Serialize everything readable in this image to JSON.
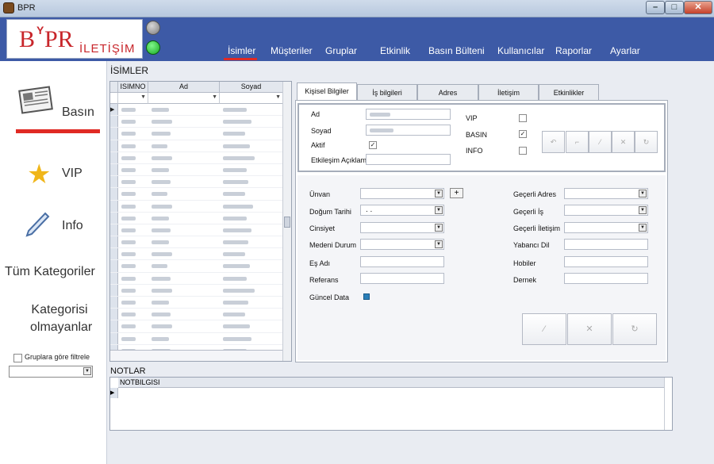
{
  "window": {
    "title": "BPR",
    "min": "–",
    "max": "□",
    "close": "✕"
  },
  "logo": {
    "b": "B",
    "y": "Y",
    "pr": "PR",
    "sub": "İLETİŞİM"
  },
  "nav": {
    "tabs": [
      "İsimler",
      "Müşteriler",
      "Gruplar",
      "Etkinlik",
      "Basın Bülteni",
      "Kullanıcılar",
      "Raporlar",
      "Ayarlar"
    ],
    "active": "İsimler"
  },
  "sidebar": {
    "basin": "Basın",
    "vip": "VIP",
    "info": "Info",
    "tum_kategoriler": "Tüm Kategoriler",
    "kategorisi_olmayanlar": "Kategorisi olmayanlar",
    "group_filter": "Gruplara göre filtrele"
  },
  "names": {
    "title": "İSİMLER",
    "columns": [
      "ISIMNO",
      "Ad",
      "Soyad"
    ],
    "row_count": 21
  },
  "detail": {
    "tabs": [
      "Kişisel Bilgiler",
      "İş bilgileri",
      "Adres",
      "İletişim",
      "Etkinlikler"
    ],
    "ad": "Ad",
    "soyad": "Soyad",
    "aktif": "Aktif",
    "etkilesim": "Etkileşim Açıklama",
    "vip": "VIP",
    "basin": "BASIN",
    "info": "INFO",
    "left_fields": [
      "Ünvan",
      "Doğum Tarihi",
      "Cinsiyet",
      "Medeni Durum",
      "Eş Adı",
      "Referans",
      "Güncel Data"
    ],
    "right_fields": [
      "Geçerli Adres",
      "Geçerli İş",
      "Geçerli İletişim",
      "Yabancı Dil",
      "Hobiler",
      "Dernek"
    ],
    "dogum_value": ". .",
    "plus": "+"
  },
  "notes": {
    "title": "NOTLAR",
    "column": "NOTBILGISI"
  }
}
